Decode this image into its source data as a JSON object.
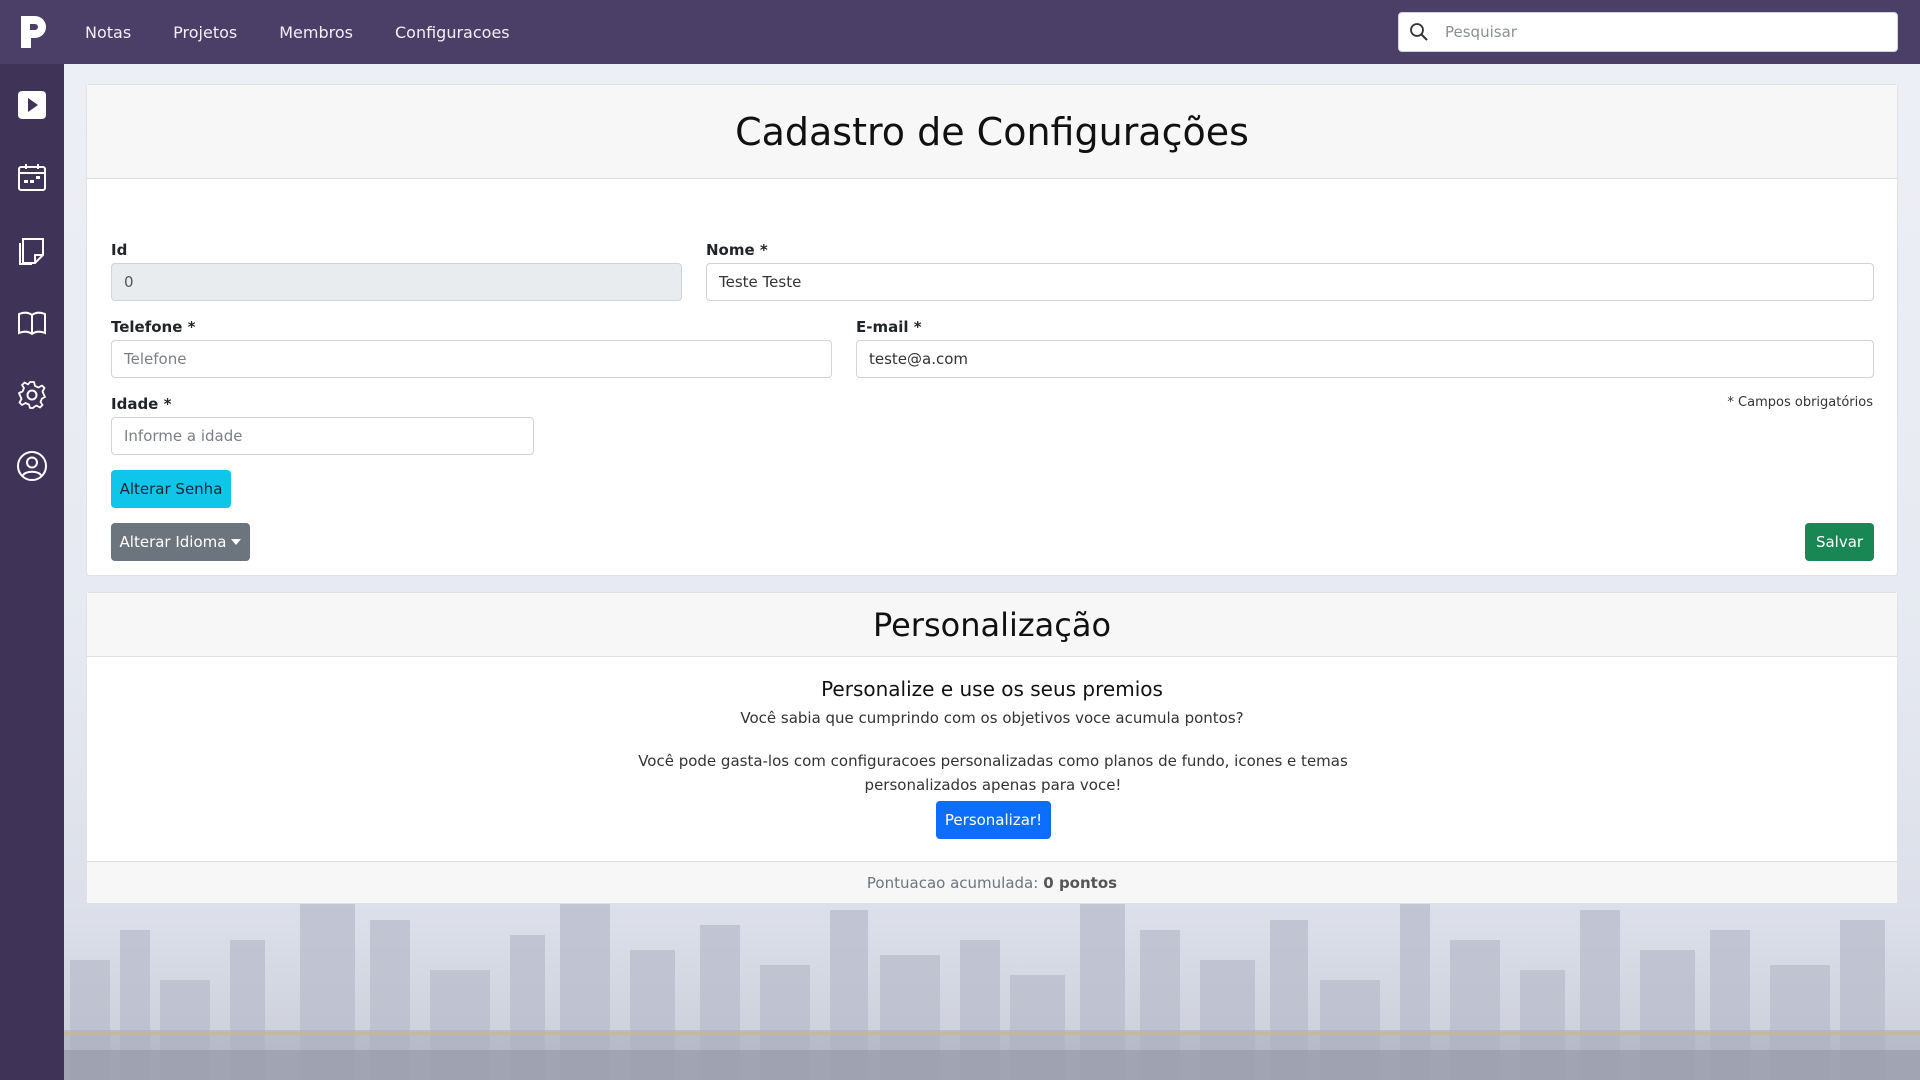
{
  "topbar": {
    "nav": [
      "Notas",
      "Projetos",
      "Membros",
      "Configuracoes"
    ],
    "search_placeholder": "Pesquisar"
  },
  "sidebar": {
    "items": [
      "play-icon",
      "calendar-icon",
      "notes-icon",
      "book-icon",
      "gear-icon",
      "user-icon"
    ]
  },
  "form": {
    "title": "Cadastro de Configurações",
    "id_label": "Id",
    "id_value": "0",
    "nome_label": "Nome *",
    "nome_value": "Teste Teste",
    "telefone_label": "Telefone *",
    "telefone_placeholder": "Telefone",
    "email_label": "E-mail *",
    "email_value": "teste@a.com",
    "idade_label": "Idade *",
    "idade_placeholder": "Informe a idade",
    "required_note": "* Campos obrigatórios",
    "change_password": "Alterar Senha",
    "change_language": "Alterar Idioma",
    "save": "Salvar"
  },
  "personalization": {
    "title": "Personalização",
    "subtitle": "Personalize e use os seus premios",
    "text1": "Você sabia que cumprindo com os objetivos voce acumula pontos?",
    "text2": "Você pode gasta-los com configuracoes personalizadas como planos de fundo, icones e temas personalizados apenas para voce!",
    "button": "Personalizar!",
    "points_label": "Pontuacao acumulada:",
    "points_value": "0 pontos"
  },
  "colors": {
    "topbar": "#4b3f68",
    "sidebar": "#3f3458",
    "info": "#0fc6ea",
    "secondary": "#6c757d",
    "success": "#198754",
    "primary": "#0d6efd"
  }
}
